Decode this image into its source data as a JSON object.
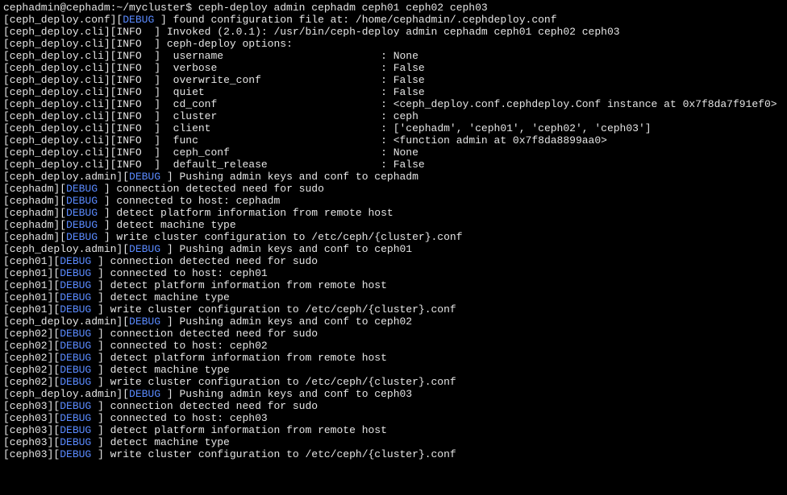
{
  "prompt": "cephadmin@cephadm:~/mycluster$ ",
  "command": "ceph-deploy admin cephadm ceph01 ceph02 ceph03",
  "conf_line": {
    "prefix": "[ceph_deploy.conf][",
    "level": "DEBUG",
    "suffix": " ] found configuration file at: /home/cephadmin/.cephdeploy.conf"
  },
  "cli": {
    "prefix": "[ceph_deploy.cli][",
    "level": "INFO",
    "suffix": "  ] ",
    "lines": [
      "Invoked (2.0.1): /usr/bin/ceph-deploy admin cephadm ceph01 ceph02 ceph03",
      "ceph-deploy options:"
    ],
    "opts": [
      {
        "k": " username",
        "v": "None"
      },
      {
        "k": " verbose",
        "v": "False"
      },
      {
        "k": " overwrite_conf",
        "v": "False"
      },
      {
        "k": " quiet",
        "v": "False"
      },
      {
        "k": " cd_conf",
        "v": "<ceph_deploy.conf.cephdeploy.Conf instance at 0x7f8da7f91ef0>"
      },
      {
        "k": " cluster",
        "v": "ceph"
      },
      {
        "k": " client",
        "v": "['cephadm', 'ceph01', 'ceph02', 'ceph03']"
      },
      {
        "k": " func",
        "v": "<function admin at 0x7f8da8899aa0>"
      },
      {
        "k": " ceph_conf",
        "v": "None"
      },
      {
        "k": " default_release",
        "v": "False"
      }
    ]
  },
  "admin": {
    "prefix": "[ceph_deploy.admin][",
    "level": "DEBUG",
    "suffix": " ] Pushing admin keys and conf to "
  },
  "hosts": [
    "cephadm",
    "ceph01",
    "ceph02",
    "ceph03"
  ],
  "host_level": "DEBUG",
  "host_msgs": [
    "connection detected need for sudo",
    "connected to host: ",
    "detect platform information from remote host",
    "detect machine type",
    "write cluster configuration to /etc/ceph/{cluster}.conf"
  ]
}
